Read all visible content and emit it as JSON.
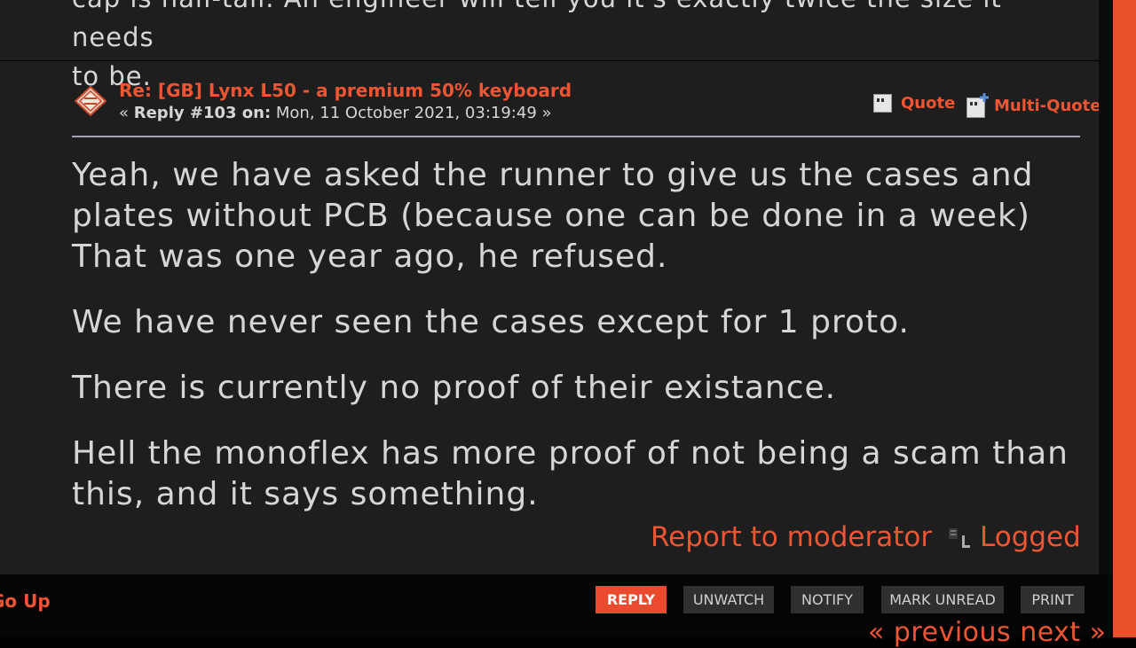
{
  "previous_post": {
    "trailing_text": "cap is half-tall. An engineer will tell you it's exactly twice the size it needs",
    "last_line": "to be."
  },
  "post": {
    "title": "Re: [GB] Lynx L50 - a premium 50% keyboard",
    "meta_open": "« ",
    "reply_label": "Reply #103 on:",
    "date": " Mon, 11 October 2021, 03:19:49 »",
    "actions": {
      "quote": "Quote",
      "multi_quote": "Multi-Quote"
    },
    "body": [
      "Yeah, we have asked the runner to give us the cases and plates without PCB (because one can be done in a week)",
      "That was one year ago, he refused.",
      "We have never seen the cases except for 1 proto.",
      "There is currently no proof of their existance.",
      "Hell the monoflex has more proof of not being a scam than this, and it says something."
    ],
    "footer": {
      "report": "Report to moderator",
      "logged": "Logged"
    }
  },
  "bottom_bar": {
    "go_up": "Go Up",
    "buttons": {
      "reply": "REPLY",
      "unwatch": "UNWATCH",
      "notify": "NOTIFY",
      "mark_unread": "MARK UNREAD",
      "print": "PRINT"
    },
    "pagination": "« previous next »"
  },
  "colors": {
    "accent": "#ee5533",
    "panel_bg": "#1e1e1e",
    "text": "#d6d6d6",
    "reply_button": "#ea4a2d"
  },
  "icons": {
    "post_icon": "post-xx-icon",
    "quote_icon": "quote-icon",
    "multi_quote_icon": "multi-quote-icon",
    "logged_icon": "ip-logged-icon"
  }
}
